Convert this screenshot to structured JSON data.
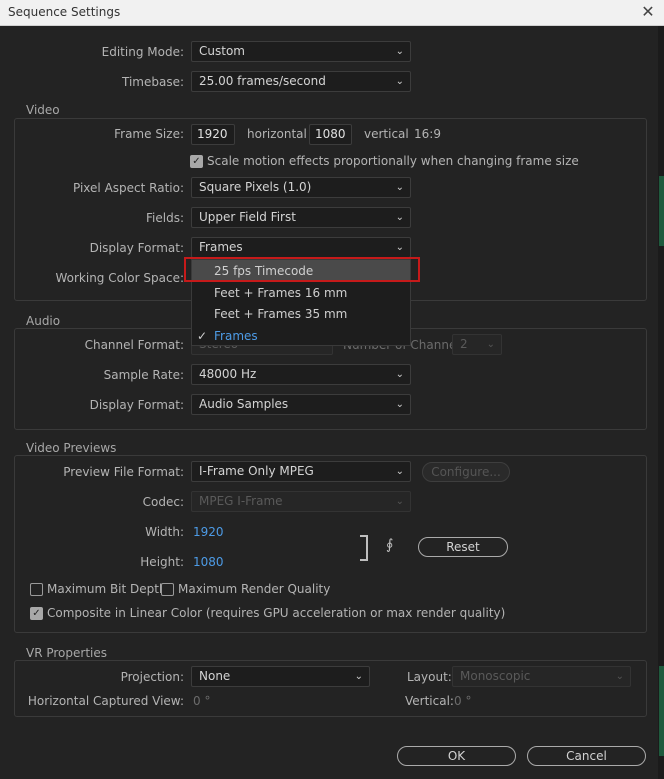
{
  "window": {
    "title": "Sequence Settings",
    "close": "✕"
  },
  "editing_mode": {
    "label": "Editing Mode:",
    "value": "Custom"
  },
  "timebase": {
    "label": "Timebase:",
    "value": "25.00  frames/second"
  },
  "video": {
    "section": "Video",
    "frame_size_label": "Frame Size:",
    "width": "1920",
    "horizontal": "horizontal",
    "height": "1080",
    "vertical": "vertical",
    "aspect": "16:9",
    "scale_motion": {
      "label": "Scale motion effects proportionally when changing frame size",
      "checked": true
    },
    "pixel_aspect_label": "Pixel Aspect Ratio:",
    "pixel_aspect": "Square Pixels (1.0)",
    "fields_label": "Fields:",
    "fields": "Upper Field First",
    "display_format_label": "Display Format:",
    "display_format": "Frames",
    "working_color_label": "Working Color Space:"
  },
  "display_format_menu": {
    "items": [
      "25 fps Timecode",
      "Feet + Frames 16 mm",
      "Feet + Frames 35 mm",
      "Frames"
    ],
    "hovered": "25 fps Timecode",
    "selected": "Frames"
  },
  "audio": {
    "section": "Audio",
    "channel_format_label": "Channel Format:",
    "channel_format": "Stereo",
    "num_channels_label": "Number of Channels:",
    "num_channels": "2",
    "sample_rate_label": "Sample Rate:",
    "sample_rate": "48000 Hz",
    "display_format_label": "Display Format:",
    "display_format": "Audio Samples"
  },
  "previews": {
    "section": "Video Previews",
    "file_format_label": "Preview File Format:",
    "file_format": "I-Frame Only MPEG",
    "configure": "Configure...",
    "codec_label": "Codec:",
    "codec": "MPEG I-Frame",
    "width_label": "Width:",
    "width": "1920",
    "height_label": "Height:",
    "height": "1080",
    "reset": "Reset",
    "max_bit_depth": {
      "label": "Maximum Bit Depth",
      "checked": false
    },
    "max_render_quality": {
      "label": "Maximum Render Quality",
      "checked": false
    },
    "linear_color": {
      "label": "Composite in Linear Color (requires GPU acceleration or max render quality)",
      "checked": true
    }
  },
  "vr": {
    "section": "VR Properties",
    "projection_label": "Projection:",
    "projection": "None",
    "layout_label": "Layout:",
    "layout": "Monoscopic",
    "hcv_label": "Horizontal Captured View:",
    "hcv": "0 °",
    "vertical_label": "Vertical:",
    "vertical": "0 °"
  },
  "footer": {
    "ok": "OK",
    "cancel": "Cancel"
  },
  "icons": {
    "chevron": "chevron-down-icon",
    "check": "checkmark-icon",
    "link": "link-chain-icon",
    "close": "close-icon"
  }
}
